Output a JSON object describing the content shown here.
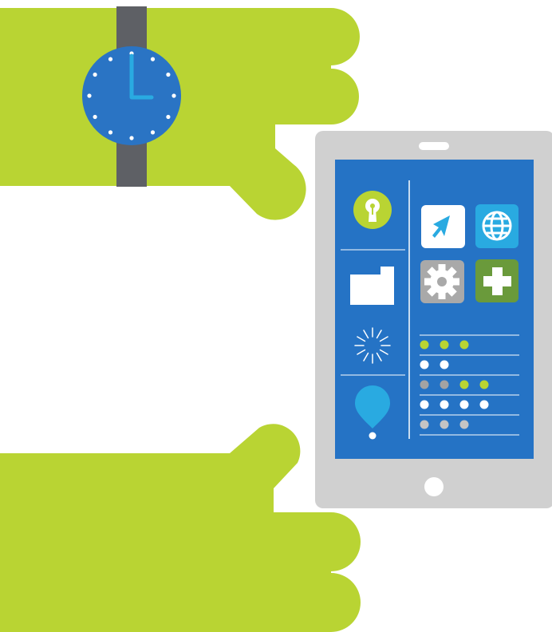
{
  "scene": {
    "background": "#ffffff",
    "hand_color": "#b9d433",
    "watch": {
      "strap_color": "#5e6065",
      "face_color": "#2a74c4",
      "hands_color": "#29aae1",
      "marker_color": "#ffffff",
      "hour_markers": 12
    },
    "tablet": {
      "body_color": "#d0d0d0",
      "screen_color": "#2573c5",
      "divider_color": "#ffffff",
      "sidebar_icons": [
        "keyhole-icon",
        "folder-icon",
        "loading-spinner-icon",
        "location-pin-icon"
      ],
      "app_tiles": [
        {
          "icon": "navigation-arrow-icon",
          "tile_color": "#ffffff",
          "glyph_color": "#29aae1"
        },
        {
          "icon": "globe-icon",
          "tile_color": "#29aae1",
          "glyph_color": "#ffffff"
        },
        {
          "icon": "gear-icon",
          "tile_color": "#a9a9a9",
          "glyph_color": "#ffffff"
        },
        {
          "icon": "plus-icon",
          "tile_color": "#6a9a3b",
          "glyph_color": "#ffffff"
        }
      ],
      "list_rows": [
        [
          "#b9d433",
          "#b9d433",
          "#b9d433"
        ],
        [
          "#ffffff",
          "#ffffff"
        ],
        [
          "#a3a3a3",
          "#a3a3a3",
          "#b9d433",
          "#b9d433"
        ],
        [
          "#ffffff",
          "#ffffff",
          "#ffffff",
          "#ffffff"
        ],
        [
          "#c4c4c4",
          "#c4c4c4",
          "#c4c4c4"
        ]
      ]
    }
  }
}
